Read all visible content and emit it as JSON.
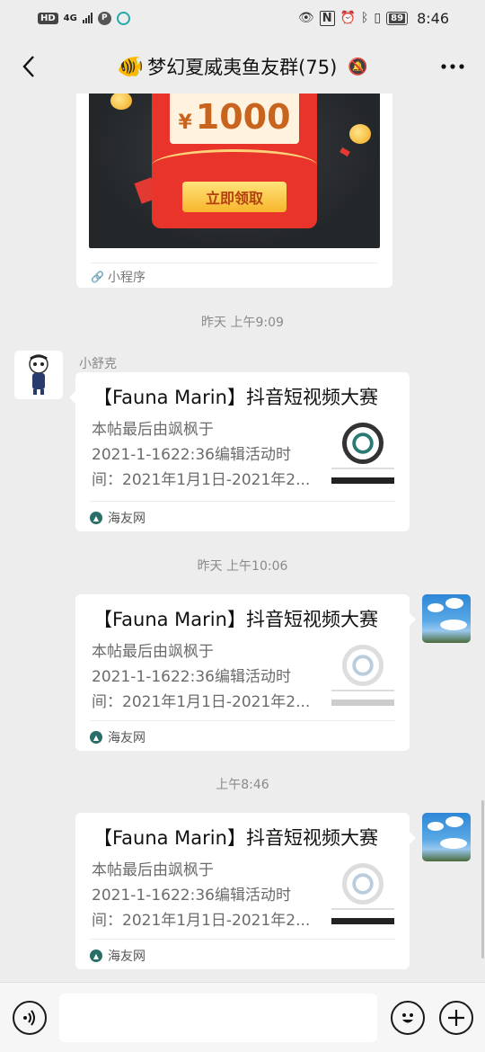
{
  "status_bar": {
    "hd": "HD",
    "network": "4G",
    "p_icon": "P",
    "battery": "89",
    "time": "8:46",
    "icons": [
      "eye-icon",
      "nfc-icon",
      "alarm-icon",
      "bluetooth-icon",
      "vibrate-icon"
    ]
  },
  "nav": {
    "title": "梦幻夏威夷鱼友群(75)",
    "title_emoji": "🐠",
    "icons": [
      "back-icon",
      "mute-icon",
      "more-icon"
    ]
  },
  "messages": [
    {
      "type": "mini_program",
      "amount": "1000",
      "currency": "¥",
      "button": "立即领取",
      "source": "小程序"
    },
    {
      "type": "timestamp",
      "text": "昨天 上午9:09"
    },
    {
      "type": "link_card",
      "side": "left",
      "sender": "小舒克",
      "title": "【Fauna Marin】抖音短视频大赛",
      "desc_lines": [
        "本帖最后由飒枫于",
        "2021-1-1622:36编辑活动时",
        "间：2021年1月1日-2021年2..."
      ],
      "source": "海友网"
    },
    {
      "type": "timestamp",
      "text": "昨天 上午10:06"
    },
    {
      "type": "link_card",
      "side": "right",
      "title": "【Fauna Marin】抖音短视频大赛",
      "desc_lines": [
        "本帖最后由飒枫于",
        "2021-1-1622:36编辑活动时",
        "间：2021年1月1日-2021年2..."
      ],
      "source": "海友网"
    },
    {
      "type": "timestamp",
      "text": "上午8:46"
    },
    {
      "type": "link_card",
      "side": "right",
      "title": "【Fauna Marin】抖音短视频大赛",
      "desc_lines": [
        "本帖最后由飒枫于",
        "2021-1-1622:36编辑活动时",
        "间：2021年1月1日-2021年2..."
      ],
      "source": "海友网"
    }
  ],
  "input_bar": {
    "placeholder": "",
    "icons": [
      "voice-icon",
      "emoji-icon",
      "plus-icon"
    ]
  },
  "colors": {
    "background": "#ededed",
    "bubble": "#ffffff",
    "timestamp": "#8a8a8a",
    "red_packet": "#e8342a",
    "source_icon": "#2a6e6a"
  }
}
